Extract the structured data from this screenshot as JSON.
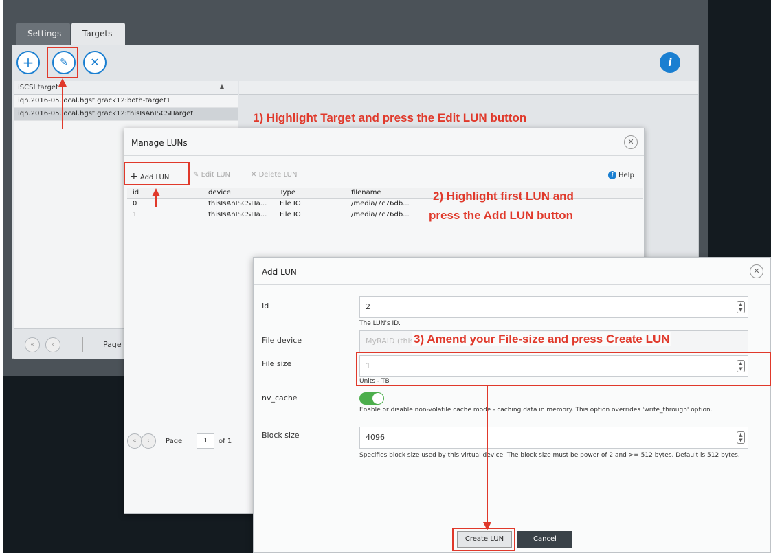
{
  "main": {
    "tabs": [
      {
        "label": "Settings"
      },
      {
        "label": "Targets"
      }
    ],
    "toolbar": {
      "add_glyph": "+",
      "edit_glyph": "✎",
      "remove_glyph": "✕",
      "info_glyph": "i"
    },
    "target_list": {
      "header": "iSCSI target",
      "rows": [
        "iqn.2016-05.local.hgst.grack12:both-target1",
        "iqn.2016-05.local.hgst.grack12:thisIsAnISCSITarget"
      ]
    },
    "pager": {
      "first": "«",
      "prev": "‹",
      "page_label": "Page"
    }
  },
  "manage_luns": {
    "title": "Manage LUNs",
    "close": "✕",
    "toolbar": {
      "add": "Add LUN",
      "edit": "Edit LUN",
      "delete": "Delete LUN",
      "help": "Help"
    },
    "columns": [
      "id",
      "device",
      "Type",
      "filename"
    ],
    "rows": [
      [
        "0",
        "thisIsAnISCSITa...",
        "File IO",
        "/media/7c76db..."
      ],
      [
        "1",
        "thisIsAnISCSITa...",
        "File IO",
        "/media/7c76db..."
      ]
    ],
    "pager": {
      "page_label": "Page",
      "page": "1",
      "of": "of 1"
    }
  },
  "add_lun": {
    "title": "Add LUN",
    "close": "✕",
    "fields": {
      "id": {
        "label": "Id",
        "value": "2",
        "help": "The LUN's ID."
      },
      "file_device": {
        "label": "File device",
        "value": "MyRAID (thisIsAnISCSITarget)"
      },
      "file_size": {
        "label": "File size",
        "value": "1",
        "help": "Units - TB"
      },
      "nv_cache": {
        "label": "nv_cache",
        "enabled": true,
        "help": "Enable or disable non-volatile cache mode - caching data in memory. This option overrides 'write_through' option."
      },
      "block_size": {
        "label": "Block size",
        "value": "4096",
        "help": "Specifies block size used by this virtual device. The block size must be power of 2 and >= 512 bytes. Default is 512 bytes."
      }
    },
    "buttons": {
      "create": "Create LUN",
      "cancel": "Cancel"
    }
  },
  "annotations": {
    "step1": "1) Highlight Target and press the Edit LUN button",
    "step2a": "2) Highlight first LUN and",
    "step2b": "press the Add LUN button",
    "step3": "3) Amend your File-size and press Create LUN"
  },
  "colors": {
    "accent": "#1a7fd1",
    "annotation": "#e0392b",
    "toggle_on": "#4cae4c"
  }
}
